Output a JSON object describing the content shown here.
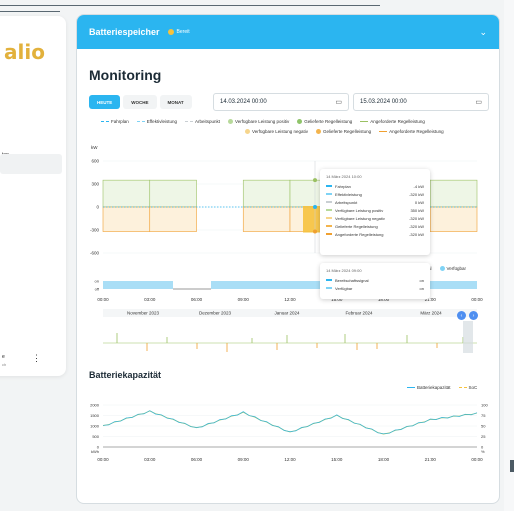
{
  "sidebar": {
    "logo": "alio",
    "items": [
      {
        "label": "ten"
      }
    ],
    "user": {
      "name": "e",
      "sub": "ch"
    }
  },
  "header": {
    "title": "Batteriespeicher",
    "status": "Bereit",
    "colors": {
      "accent": "#2bb5f0",
      "status": "#f6c23e"
    }
  },
  "page": {
    "title": "Monitoring"
  },
  "tabs": [
    {
      "label": "HEUTE"
    },
    {
      "label": "WOCHE"
    },
    {
      "label": "MONAT"
    }
  ],
  "dates": {
    "from": "14.03.2024 00:00",
    "to": "15.03.2024 00:00"
  },
  "legend1": [
    {
      "label": "Fahrplan",
      "color": "#2bb5f0",
      "style": "dash"
    },
    {
      "label": "Effektivleistung",
      "color": "#7fd3f5",
      "style": "dash"
    },
    {
      "label": "Arbeitspunkt",
      "color": "#c9cfd3",
      "style": "dash"
    },
    {
      "label": "Verfügbare Leistung positiv",
      "color": "#b7d99a",
      "style": "dot"
    },
    {
      "label": "Gelieferte Regelleistung",
      "color": "#8fc46a",
      "style": "dot"
    },
    {
      "label": "Angeforderte Regelleistung",
      "color": "#9bc163",
      "style": "line"
    },
    {
      "label": "Verfügbare Leistung negativ",
      "color": "#f6d58c",
      "style": "dot"
    },
    {
      "label": "Gelieferte Regelleistung",
      "color": "#f3b44d",
      "style": "dot"
    },
    {
      "label": "Angeforderte Regelleistung",
      "color": "#f0a030",
      "style": "line"
    }
  ],
  "legend2": [
    {
      "label": "ignal",
      "color": "#2bb5f0"
    },
    {
      "label": "Verfügbar",
      "color": "#7fd3f5"
    }
  ],
  "legend3": [
    {
      "label": "Batteriekapazität",
      "color": "#2bb5f0"
    },
    {
      "label": "SoC",
      "color": "#f6c23e"
    }
  ],
  "tooltip1": {
    "time": "14 März 2024 10:00",
    "rows": [
      {
        "label": "Fahrplan",
        "value": "-4 kW",
        "color": "#2bb5f0"
      },
      {
        "label": "Effektivleistung",
        "value": "-320 kW",
        "color": "#7fd3f5"
      },
      {
        "label": "Arbeitspunkt",
        "value": "0 kW",
        "color": "#c9cfd3"
      },
      {
        "label": "Verfügbare Leistung positiv",
        "value": "350 kW",
        "color": "#b7d99a"
      },
      {
        "label": "Verfügbare Leistung negativ",
        "value": "-320 kW",
        "color": "#f6d58c"
      },
      {
        "label": "Gelieferte Regelleistung",
        "value": "-320 kW",
        "color": "#f3b44d"
      },
      {
        "label": "Angeforderte Regelleistung",
        "value": "-320 kW",
        "color": "#f0a030"
      }
    ]
  },
  "tooltip2": {
    "time": "14 März 2024 09:00",
    "rows": [
      {
        "label": "Bereitschaftssignal",
        "value": "on",
        "color": "#2bb5f0"
      },
      {
        "label": "Verfügbar",
        "value": "on",
        "color": "#7fd3f5"
      }
    ]
  },
  "nav_months": [
    "November 2023",
    "Dezember 2023",
    "Januar 2024",
    "Februar 2024",
    "März 2024"
  ],
  "section_title": "Batteriekapazität",
  "chart_data": [
    {
      "type": "line",
      "ylabel": "kW",
      "yticks": [
        "600",
        "300",
        "0",
        "-300",
        "-600"
      ],
      "ylim": [
        -600,
        600
      ],
      "x": [
        "00:00",
        "03:00",
        "06:00",
        "09:00",
        "12:00",
        "15:00",
        "18:00",
        "21:00",
        "00:00"
      ],
      "series": [
        {
          "name": "Verfügbare Leistung positiv",
          "values": [
            350,
            350,
            0,
            350,
            350,
            0,
            350,
            350,
            350
          ]
        },
        {
          "name": "Verfügbare Leistung negativ",
          "values": [
            -320,
            -320,
            0,
            -320,
            -320,
            0,
            -320,
            -320,
            -320
          ]
        },
        {
          "name": "Fahrplan",
          "values": [
            0,
            0,
            0,
            0,
            0,
            0,
            0,
            0,
            0
          ]
        }
      ]
    },
    {
      "type": "area",
      "yticks": [
        "on",
        "off"
      ],
      "x": [
        "00:00",
        "03:00",
        "06:00",
        "09:00",
        "12:00",
        "15:00",
        "18:00",
        "21:00",
        "00:00"
      ]
    },
    {
      "type": "line",
      "ylabel": "kWh",
      "yticks": [
        "2000",
        "1500",
        "1000",
        "500",
        "0"
      ],
      "ylim": [
        0,
        2000
      ],
      "y2ticks": [
        "100",
        "75",
        "50",
        "25",
        "0"
      ],
      "y2label": "%",
      "x": [
        "00:00",
        "03:00",
        "06:00",
        "09:00",
        "12:00",
        "15:00",
        "18:00",
        "21:00",
        "00:00"
      ],
      "series": [
        {
          "name": "Batteriekapazität",
          "values": [
            1000,
            1700,
            900,
            1650,
            700,
            1500,
            600,
            1300,
            1600
          ]
        },
        {
          "name": "SoC",
          "values": [
            50,
            85,
            45,
            82,
            35,
            75,
            30,
            65,
            80
          ]
        }
      ]
    }
  ]
}
